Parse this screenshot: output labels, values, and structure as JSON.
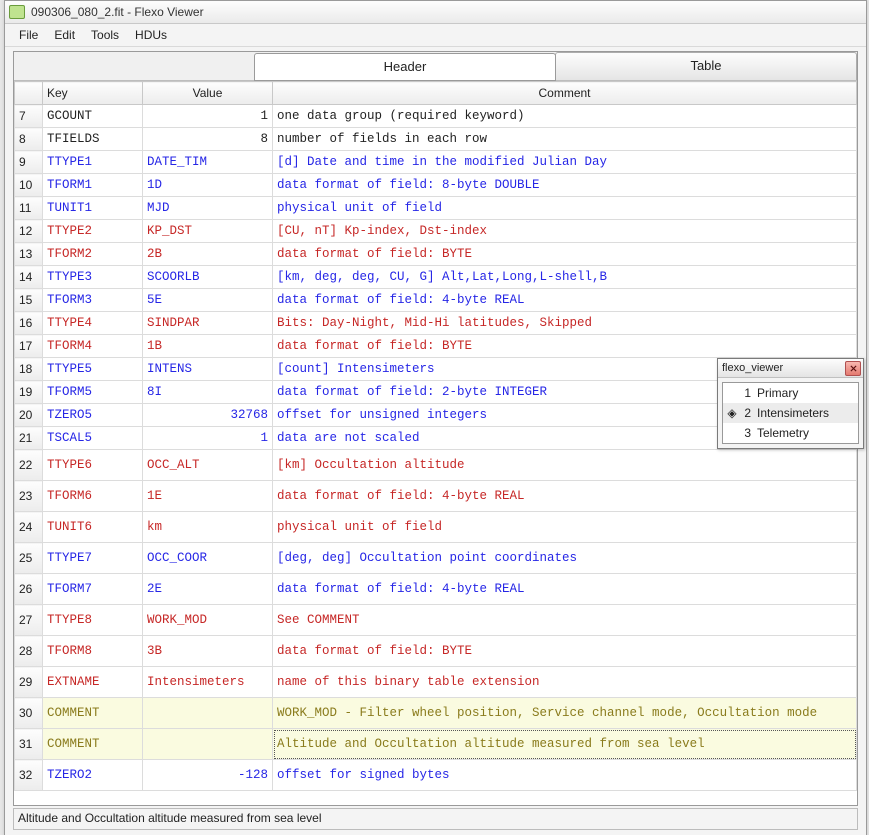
{
  "title": "090306_080_2.fit - Flexo Viewer",
  "menu": [
    "File",
    "Edit",
    "Tools",
    "HDUs"
  ],
  "tabs": {
    "active": "Header",
    "inactive": "Table"
  },
  "columns": {
    "idx": "",
    "key": "Key",
    "value": "Value",
    "comment": "Comment"
  },
  "rows": [
    {
      "n": 7,
      "key": "GCOUNT",
      "val": "1",
      "num": true,
      "cmt": "one data group (required keyword)",
      "cls": "c-black"
    },
    {
      "n": 8,
      "key": "TFIELDS",
      "val": "8",
      "num": true,
      "cmt": "number of fields in each row",
      "cls": "c-black"
    },
    {
      "n": 9,
      "key": "TTYPE1",
      "val": "DATE_TIM",
      "num": false,
      "cmt": " [d] Date and time in the modified Julian Day",
      "cls": "c-blue"
    },
    {
      "n": 10,
      "key": "TFORM1",
      "val": "1D",
      "num": false,
      "cmt": "data format of field: 8-byte DOUBLE",
      "cls": "c-blue"
    },
    {
      "n": 11,
      "key": "TUNIT1",
      "val": "MJD",
      "num": false,
      "cmt": "physical unit of field",
      "cls": "c-blue"
    },
    {
      "n": 12,
      "key": "TTYPE2",
      "val": "KP_DST",
      "num": false,
      "cmt": "[CU, nT] Kp-index, Dst-index",
      "cls": "c-red"
    },
    {
      "n": 13,
      "key": "TFORM2",
      "val": "2B",
      "num": false,
      "cmt": "data format of field: BYTE",
      "cls": "c-red"
    },
    {
      "n": 14,
      "key": "TTYPE3",
      "val": "SCOORLB",
      "num": false,
      "cmt": "[km, deg, deg, CU, G] Alt,Lat,Long,L-shell,B",
      "cls": "c-blue"
    },
    {
      "n": 15,
      "key": "TFORM3",
      "val": "5E",
      "num": false,
      "cmt": "data format of field: 4-byte REAL",
      "cls": "c-blue"
    },
    {
      "n": 16,
      "key": "TTYPE4",
      "val": "SINDPAR",
      "num": false,
      "cmt": "Bits: Day-Night, Mid-Hi latitudes, Skipped",
      "cls": "c-red"
    },
    {
      "n": 17,
      "key": "TFORM4",
      "val": "1B",
      "num": false,
      "cmt": "data format of field: BYTE",
      "cls": "c-red"
    },
    {
      "n": 18,
      "key": "TTYPE5",
      "val": "INTENS",
      "num": false,
      "cmt": "[count] Intensimeters",
      "cls": "c-blue"
    },
    {
      "n": 19,
      "key": "TFORM5",
      "val": "8I",
      "num": false,
      "cmt": "data format of field: 2-byte INTEGER",
      "cls": "c-blue"
    },
    {
      "n": 20,
      "key": "TZERO5",
      "val": "32768",
      "num": true,
      "cmt": "offset for unsigned integers",
      "cls": "c-blue"
    },
    {
      "n": 21,
      "key": "TSCAL5",
      "val": "1",
      "num": true,
      "cmt": "data are not scaled",
      "cls": "c-blue"
    },
    {
      "n": 22,
      "key": "TTYPE6",
      "val": "OCC_ALT",
      "num": false,
      "cmt": "[km] Occultation altitude",
      "cls": "c-red",
      "tall": true
    },
    {
      "n": 23,
      "key": "TFORM6",
      "val": "1E",
      "num": false,
      "cmt": "data format of field: 4-byte REAL",
      "cls": "c-red",
      "tall": true
    },
    {
      "n": 24,
      "key": "TUNIT6",
      "val": "km",
      "num": false,
      "cmt": "physical unit of field",
      "cls": "c-red",
      "tall": true
    },
    {
      "n": 25,
      "key": "TTYPE7",
      "val": "OCC_COOR",
      "num": false,
      "cmt": "[deg, deg] Occultation point coordinates",
      "cls": "c-blue",
      "tall": true
    },
    {
      "n": 26,
      "key": "TFORM7",
      "val": "2E",
      "num": false,
      "cmt": "data format of field: 4-byte REAL",
      "cls": "c-blue",
      "tall": true
    },
    {
      "n": 27,
      "key": "TTYPE8",
      "val": "WORK_MOD",
      "num": false,
      "cmt": "See COMMENT",
      "cls": "c-red",
      "tall": true
    },
    {
      "n": 28,
      "key": "TFORM8",
      "val": "3B",
      "num": false,
      "cmt": "data format of field: BYTE",
      "cls": "c-red",
      "tall": true
    },
    {
      "n": 29,
      "key": "EXTNAME",
      "val": "Intensimeters",
      "num": false,
      "cmt": "name of this binary table extension",
      "cls": "c-red",
      "tall": true
    },
    {
      "n": 30,
      "key": "COMMENT",
      "val": "",
      "num": false,
      "cmt": "WORK_MOD - Filter wheel position, Service channel mode, Occultation mode",
      "cls": "c-olive",
      "tall": true,
      "yellow": true
    },
    {
      "n": 31,
      "key": "COMMENT",
      "val": "",
      "num": false,
      "cmt": "Altitude and Occultation altitude measured from sea level",
      "cls": "c-olive",
      "tall": true,
      "yellow": true,
      "selected": true
    },
    {
      "n": 32,
      "key": "TZERO2",
      "val": "-128",
      "num": true,
      "cmt": "offset for signed bytes",
      "cls": "c-blue",
      "tall": true
    }
  ],
  "status": "Altitude and Occultation altitude measured from sea level",
  "palette": {
    "title": "flexo_viewer",
    "items": [
      {
        "n": "1",
        "label": "Primary",
        "selected": false
      },
      {
        "n": "2",
        "label": "Intensimeters",
        "selected": true
      },
      {
        "n": "3",
        "label": "Telemetry",
        "selected": false
      }
    ]
  }
}
